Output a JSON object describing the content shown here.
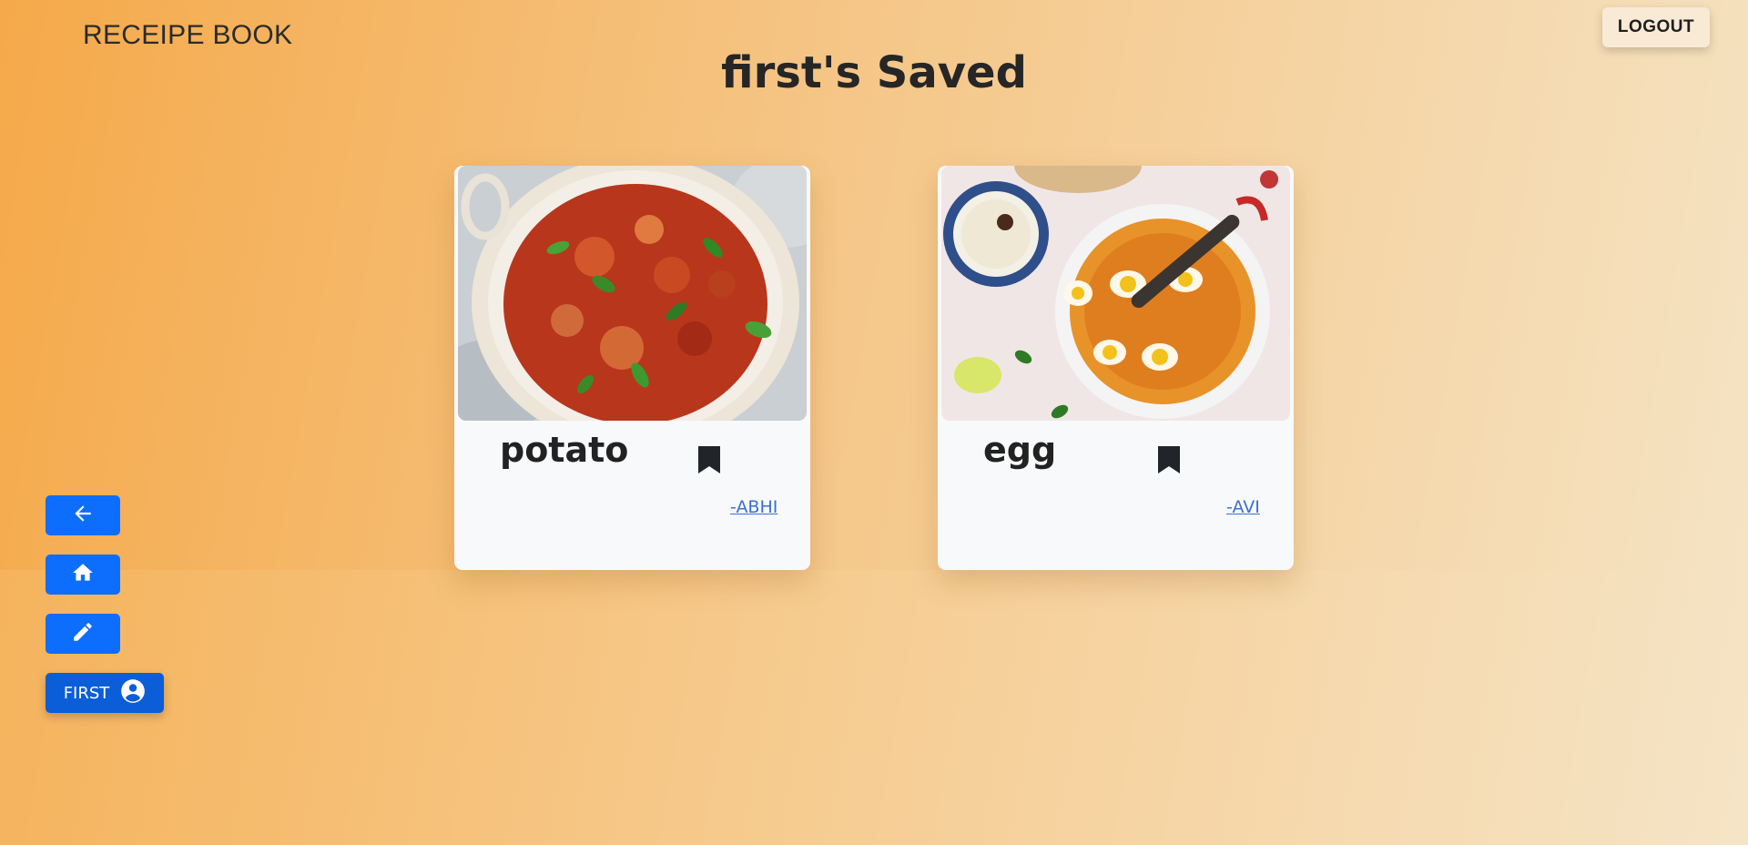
{
  "header": {
    "brand": "RECEIPE BOOK",
    "logout_label": "LOGOUT"
  },
  "page": {
    "title": "first's Saved"
  },
  "recipes": [
    {
      "name": "potato",
      "author": "-ABHI",
      "image_icon": "potato-curry-photo",
      "saved": true
    },
    {
      "name": "egg",
      "author": "-AVI",
      "image_icon": "egg-curry-photo",
      "saved": true
    }
  ],
  "sidebar": {
    "back_icon": "arrow-left-icon",
    "home_icon": "home-icon",
    "edit_icon": "pencil-icon",
    "user_label": "FIRST",
    "user_icon": "account-circle-icon"
  },
  "colors": {
    "primary_button": "#0d6efd",
    "user_button": "#0b5ed7",
    "author_link": "#3b6fd6"
  }
}
